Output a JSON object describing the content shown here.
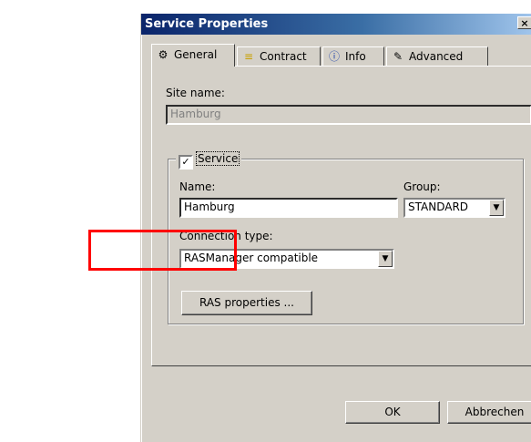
{
  "window": {
    "title": "Service Properties",
    "close_glyph": "×"
  },
  "tabs": [
    {
      "label": "General",
      "icon": "gear-icon",
      "glyph": "⚙"
    },
    {
      "label": "Contract",
      "icon": "database-icon",
      "glyph": "≡"
    },
    {
      "label": "Info",
      "icon": "info-icon",
      "glyph": "ⓘ"
    },
    {
      "label": "Advanced",
      "icon": "wrench-icon",
      "glyph": "✎"
    }
  ],
  "general": {
    "site_name_label": "Site name:",
    "site_name_value": "Hamburg",
    "service_checkbox_label": "Service",
    "service_checked_glyph": "✓",
    "name_label": "Name:",
    "name_value": "Hamburg",
    "group_label": "Group:",
    "group_value": "STANDARD",
    "connection_type_label": "Connection type:",
    "connection_type_value": "RASManager compatible",
    "ras_properties_button": "RAS properties ...",
    "dropdown_glyph": "▼"
  },
  "footer": {
    "ok_label": "OK",
    "cancel_label": "Abbrechen"
  },
  "colors": {
    "highlight": "#ff0000",
    "title_bar": "#0a246a",
    "dialog_face": "#d4d0c8"
  }
}
